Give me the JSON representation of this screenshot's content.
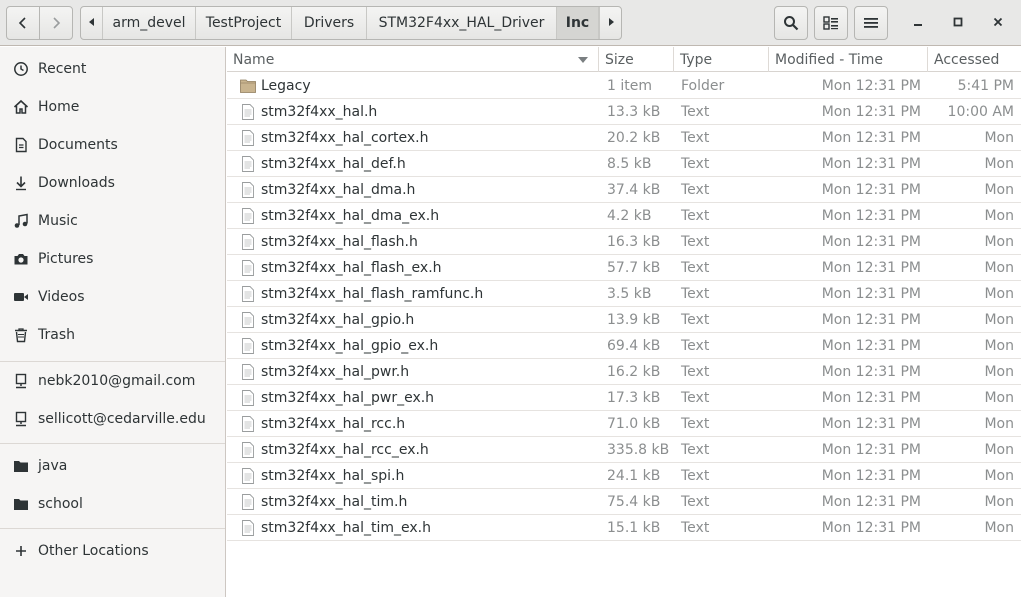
{
  "navigation": {
    "back_icon": "chevron-left-icon",
    "forward_icon": "chevron-right-icon"
  },
  "breadcrumb": {
    "items": [
      "arm_devel",
      "TestProject",
      "Drivers",
      "STM32F4xx_HAL_Driver",
      "Inc"
    ],
    "active_index": 4
  },
  "toolbar": {
    "search_icon": "search-icon",
    "view_icon": "list-view-icon",
    "menu_icon": "hamburger-menu-icon"
  },
  "window_controls": {
    "minimize_icon": "minimize-icon",
    "maximize_icon": "maximize-icon",
    "close_icon": "close-icon"
  },
  "sidebar": {
    "places": [
      {
        "label": "Recent",
        "icon": "clock-icon"
      },
      {
        "label": "Home",
        "icon": "home-icon"
      },
      {
        "label": "Documents",
        "icon": "document-icon"
      },
      {
        "label": "Downloads",
        "icon": "download-icon"
      },
      {
        "label": "Music",
        "icon": "music-icon"
      },
      {
        "label": "Pictures",
        "icon": "camera-icon"
      },
      {
        "label": "Videos",
        "icon": "video-icon"
      },
      {
        "label": "Trash",
        "icon": "trash-icon"
      }
    ],
    "accounts": [
      {
        "label": "nebk2010@gmail.com",
        "icon": "network-account-icon"
      },
      {
        "label": "sellicott@cedarville.edu",
        "icon": "network-account-icon"
      }
    ],
    "bookmarks": [
      {
        "label": "java",
        "icon": "folder-icon"
      },
      {
        "label": "school",
        "icon": "folder-icon"
      }
    ],
    "other": {
      "label": "Other Locations",
      "icon": "plus-icon"
    }
  },
  "columns": {
    "name": "Name",
    "size": "Size",
    "type": "Type",
    "modified": "Modified - Time",
    "accessed": "Accessed"
  },
  "files": [
    {
      "name": "Legacy",
      "size": "1 item",
      "type": "Folder",
      "modified": "Mon 12:31 PM",
      "accessed": "5:41 PM",
      "icon": "folder-icon"
    },
    {
      "name": "stm32f4xx_hal.h",
      "size": "13.3 kB",
      "type": "Text",
      "modified": "Mon 12:31 PM",
      "accessed": "10:00 AM",
      "icon": "text-file-icon"
    },
    {
      "name": "stm32f4xx_hal_cortex.h",
      "size": "20.2 kB",
      "type": "Text",
      "modified": "Mon 12:31 PM",
      "accessed": "Mon",
      "icon": "text-file-icon"
    },
    {
      "name": "stm32f4xx_hal_def.h",
      "size": "8.5 kB",
      "type": "Text",
      "modified": "Mon 12:31 PM",
      "accessed": "Mon",
      "icon": "text-file-icon"
    },
    {
      "name": "stm32f4xx_hal_dma.h",
      "size": "37.4 kB",
      "type": "Text",
      "modified": "Mon 12:31 PM",
      "accessed": "Mon",
      "icon": "text-file-icon"
    },
    {
      "name": "stm32f4xx_hal_dma_ex.h",
      "size": "4.2 kB",
      "type": "Text",
      "modified": "Mon 12:31 PM",
      "accessed": "Mon",
      "icon": "text-file-icon"
    },
    {
      "name": "stm32f4xx_hal_flash.h",
      "size": "16.3 kB",
      "type": "Text",
      "modified": "Mon 12:31 PM",
      "accessed": "Mon",
      "icon": "text-file-icon"
    },
    {
      "name": "stm32f4xx_hal_flash_ex.h",
      "size": "57.7 kB",
      "type": "Text",
      "modified": "Mon 12:31 PM",
      "accessed": "Mon",
      "icon": "text-file-icon"
    },
    {
      "name": "stm32f4xx_hal_flash_ramfunc.h",
      "size": "3.5 kB",
      "type": "Text",
      "modified": "Mon 12:31 PM",
      "accessed": "Mon",
      "icon": "text-file-icon"
    },
    {
      "name": "stm32f4xx_hal_gpio.h",
      "size": "13.9 kB",
      "type": "Text",
      "modified": "Mon 12:31 PM",
      "accessed": "Mon",
      "icon": "text-file-icon"
    },
    {
      "name": "stm32f4xx_hal_gpio_ex.h",
      "size": "69.4 kB",
      "type": "Text",
      "modified": "Mon 12:31 PM",
      "accessed": "Mon",
      "icon": "text-file-icon"
    },
    {
      "name": "stm32f4xx_hal_pwr.h",
      "size": "16.2 kB",
      "type": "Text",
      "modified": "Mon 12:31 PM",
      "accessed": "Mon",
      "icon": "text-file-icon"
    },
    {
      "name": "stm32f4xx_hal_pwr_ex.h",
      "size": "17.3 kB",
      "type": "Text",
      "modified": "Mon 12:31 PM",
      "accessed": "Mon",
      "icon": "text-file-icon"
    },
    {
      "name": "stm32f4xx_hal_rcc.h",
      "size": "71.0 kB",
      "type": "Text",
      "modified": "Mon 12:31 PM",
      "accessed": "Mon",
      "icon": "text-file-icon"
    },
    {
      "name": "stm32f4xx_hal_rcc_ex.h",
      "size": "335.8 kB",
      "type": "Text",
      "modified": "Mon 12:31 PM",
      "accessed": "Mon",
      "icon": "text-file-icon"
    },
    {
      "name": "stm32f4xx_hal_spi.h",
      "size": "24.1 kB",
      "type": "Text",
      "modified": "Mon 12:31 PM",
      "accessed": "Mon",
      "icon": "text-file-icon"
    },
    {
      "name": "stm32f4xx_hal_tim.h",
      "size": "75.4 kB",
      "type": "Text",
      "modified": "Mon 12:31 PM",
      "accessed": "Mon",
      "icon": "text-file-icon"
    },
    {
      "name": "stm32f4xx_hal_tim_ex.h",
      "size": "15.1 kB",
      "type": "Text",
      "modified": "Mon 12:31 PM",
      "accessed": "Mon",
      "icon": "text-file-icon"
    }
  ],
  "colors": {
    "header_bg": "#e8e8e7",
    "sidebar_bg": "#f6f5f4",
    "text": "#2e3436",
    "dim_text": "#8b8e8f",
    "folder": "#c9b48f"
  }
}
